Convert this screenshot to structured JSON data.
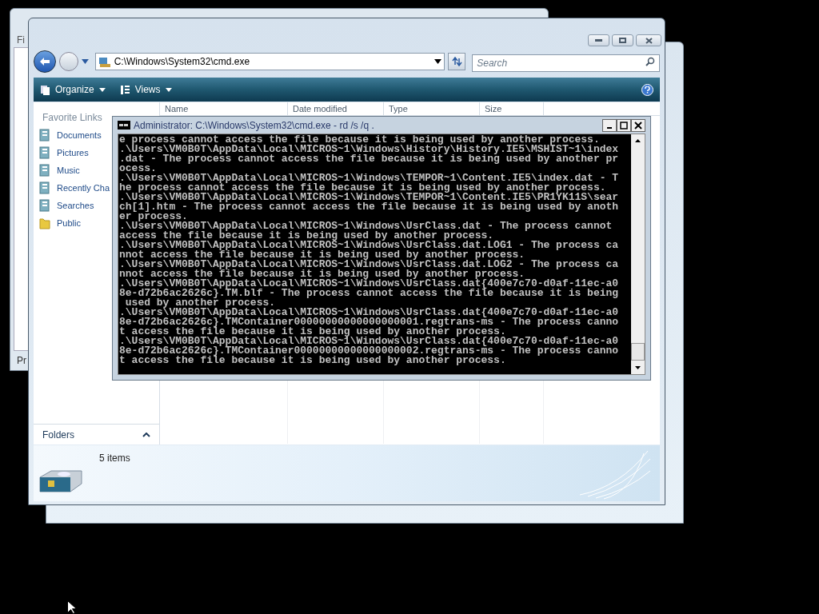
{
  "background_windows": [
    {
      "label": "Fi"
    },
    {
      "label": "Pr"
    }
  ],
  "explorer": {
    "address": "C:\\Windows\\System32\\cmd.exe",
    "search": {
      "placeholder": "Search"
    },
    "toolbar": [
      {
        "label": "Organize"
      },
      {
        "label": "Views"
      }
    ],
    "favorite_links": {
      "title": "Favorite Links",
      "items": [
        {
          "label": "Documents",
          "kind": "library"
        },
        {
          "label": "Pictures",
          "kind": "library"
        },
        {
          "label": "Music",
          "kind": "library"
        },
        {
          "label": "Recently Cha",
          "kind": "library"
        },
        {
          "label": "Searches",
          "kind": "library"
        },
        {
          "label": "Public",
          "kind": "folder"
        }
      ]
    },
    "columns": [
      "Name",
      "Date modified",
      "Type",
      "Size"
    ],
    "folders": {
      "label": "Folders",
      "expanded": false
    },
    "details": "5 items"
  },
  "console": {
    "title": "Administrator: C:\\Windows\\System32\\cmd.exe - rd  /s /q .",
    "lines": [
      "e process cannot access the file because it is being used by another process.",
      ".\\Users\\VM0B0T\\AppData\\Local\\MICROS~1\\Windows\\History\\History.IE5\\MSHIST~1\\index",
      ".dat - The process cannot access the file because it is being used by another pr",
      "ocess.",
      ".\\Users\\VM0B0T\\AppData\\Local\\MICROS~1\\Windows\\TEMPOR~1\\Content.IE5\\index.dat - T",
      "he process cannot access the file because it is being used by another process.",
      ".\\Users\\VM0B0T\\AppData\\Local\\MICROS~1\\Windows\\TEMPOR~1\\Content.IE5\\PR1YK11S\\sear",
      "ch[1].htm - The process cannot access the file because it is being used by anoth",
      "er process.",
      ".\\Users\\VM0B0T\\AppData\\Local\\MICROS~1\\Windows\\UsrClass.dat - The process cannot",
      "access the file because it is being used by another process.",
      ".\\Users\\VM0B0T\\AppData\\Local\\MICROS~1\\Windows\\UsrClass.dat.LOG1 - The process ca",
      "nnot access the file because it is being used by another process.",
      ".\\Users\\VM0B0T\\AppData\\Local\\MICROS~1\\Windows\\UsrClass.dat.LOG2 - The process ca",
      "nnot access the file because it is being used by another process.",
      ".\\Users\\VM0B0T\\AppData\\Local\\MICROS~1\\Windows\\UsrClass.dat{400e7c70-d0af-11ec-a0",
      "8e-d72b6ac2626c}.TM.blf - The process cannot access the file because it is being",
      " used by another process.",
      ".\\Users\\VM0B0T\\AppData\\Local\\MICROS~1\\Windows\\UsrClass.dat{400e7c70-d0af-11ec-a0",
      "8e-d72b6ac2626c}.TMContainer00000000000000000001.regtrans-ms - The process canno",
      "t access the file because it is being used by another process.",
      ".\\Users\\VM0B0T\\AppData\\Local\\MICROS~1\\Windows\\UsrClass.dat{400e7c70-d0af-11ec-a0",
      "8e-d72b6ac2626c}.TMContainer00000000000000000002.regtrans-ms - The process canno",
      "t access the file because it is being used by another process."
    ]
  }
}
